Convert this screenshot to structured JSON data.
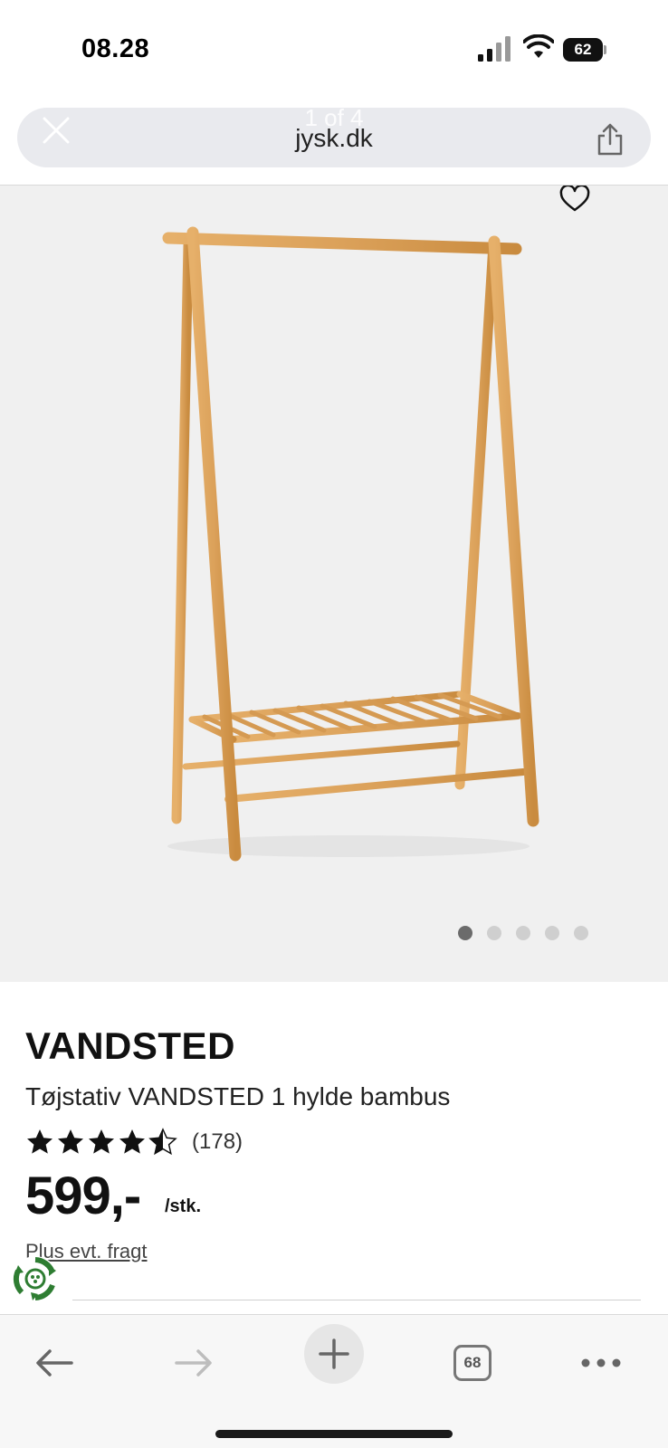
{
  "status_bar": {
    "time": "08.28",
    "battery_level": "62"
  },
  "browser": {
    "url": "jysk.dk",
    "image_counter": "1 of 4",
    "tabs_count": "68"
  },
  "product": {
    "brand": "VANDSTED",
    "name": "Tøjstativ VANDSTED 1 hylde bambus",
    "rating_value": 4.5,
    "rating_max": 5,
    "review_count": "(178)",
    "price": "599,-",
    "unit": "/stk.",
    "shipping_note": "Plus evt. fragt",
    "image_count": 5,
    "active_image": 1
  },
  "colors": {
    "bamboo": "#dfa65a",
    "bamboo_dark": "#c98b3f",
    "eco_green": "#2e7d32"
  },
  "icons": {
    "close": "close-icon",
    "share": "share-icon",
    "wishlist": "heart-icon",
    "back": "arrow-left-icon",
    "forward": "arrow-right-icon",
    "new_tab": "plus-icon",
    "tabs": "tabs-icon",
    "more": "more-icon",
    "eco": "recycle-icon"
  }
}
